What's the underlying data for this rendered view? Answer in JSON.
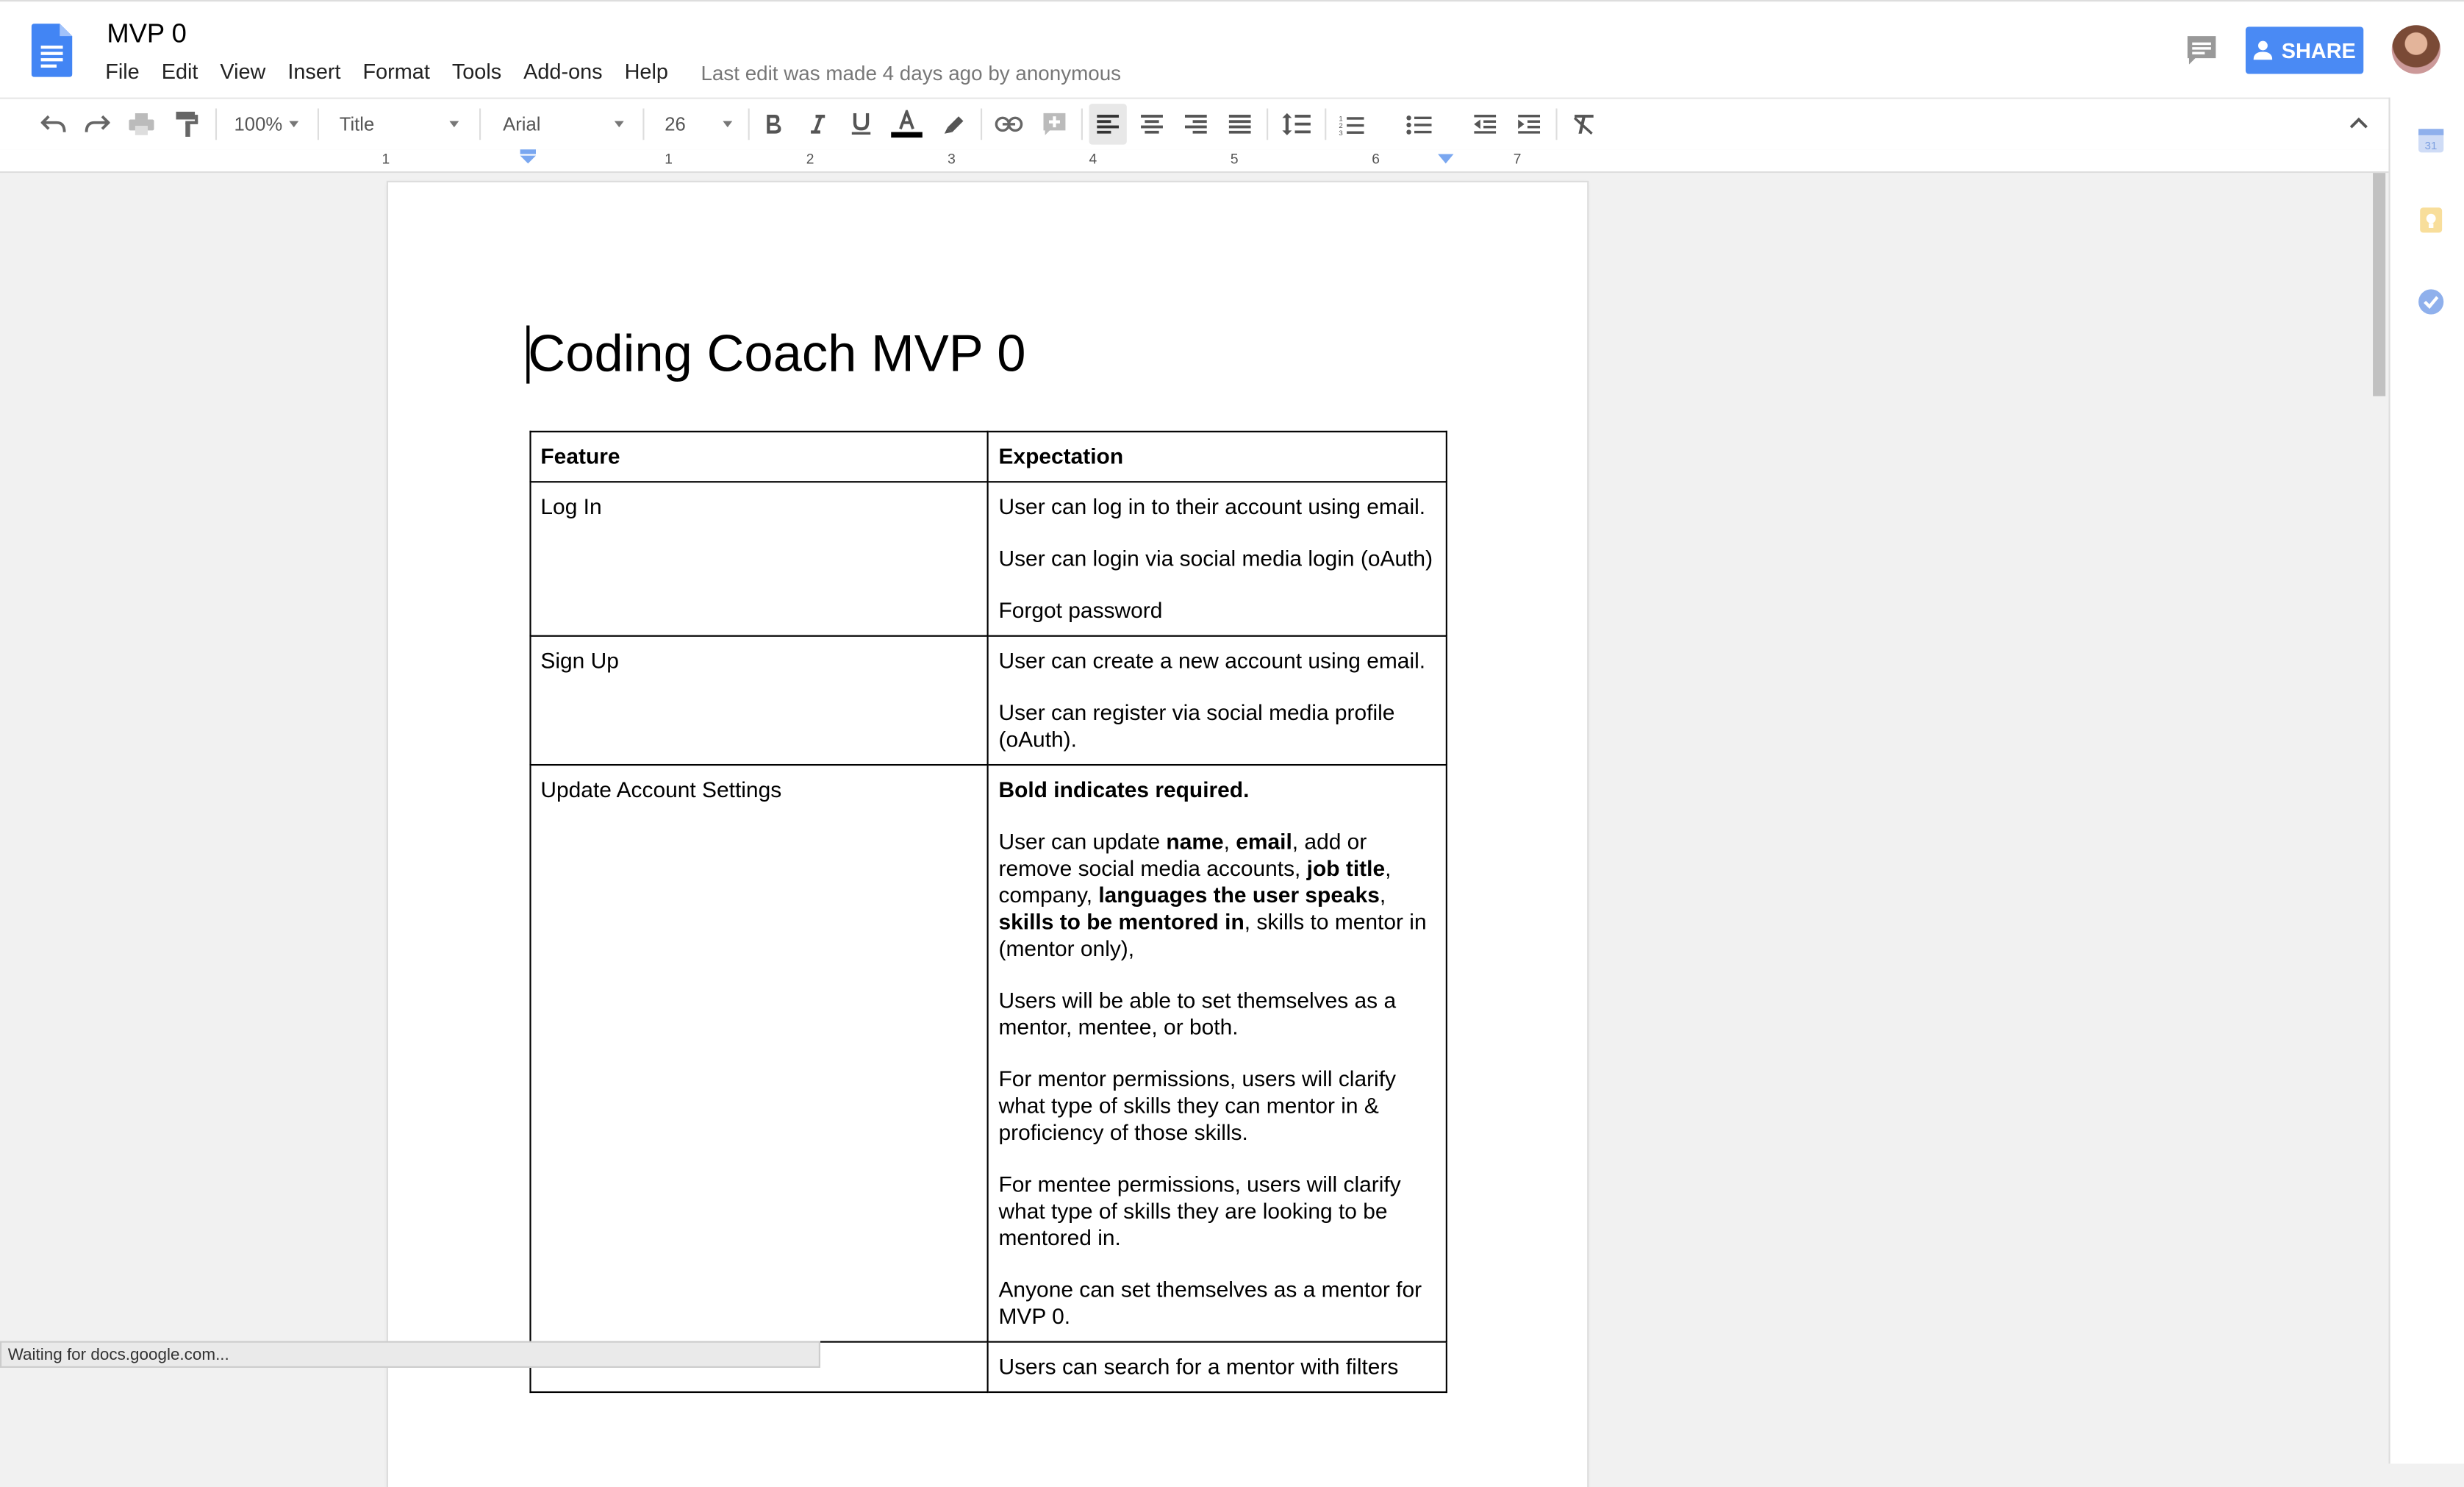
{
  "header": {
    "doc_title": "MVP 0",
    "menu": [
      "File",
      "Edit",
      "View",
      "Insert",
      "Format",
      "Tools",
      "Add-ons",
      "Help"
    ],
    "last_edit": "Last edit was made 4 days ago by anonymous",
    "share_label": "SHARE",
    "share_color": "#4a8af4"
  },
  "toolbar": {
    "zoom": "100%",
    "style": "Title",
    "font": "Arial",
    "font_size": "26",
    "text_color": "#000000"
  },
  "ruler": {
    "numbers": [
      "1",
      "1",
      "2",
      "3",
      "4",
      "5",
      "6",
      "7"
    ]
  },
  "document": {
    "heading": "Coding Coach MVP 0",
    "table": {
      "headers": [
        "Feature",
        "Expectation"
      ],
      "rows": [
        {
          "feature": "Log In",
          "exp": [
            "User can log in to their account using email.",
            "User can login via social media login (oAuth)",
            "Forgot password"
          ]
        },
        {
          "feature": "Sign Up",
          "exp": [
            "User can create a new account using email.",
            "User can register via social media profile (oAuth)."
          ]
        },
        {
          "feature": "Update Account Settings",
          "exp_bold_intro": "Bold indicates required.",
          "exp_rich": {
            "t1": "User can update ",
            "b1": "name",
            "t2": ", ",
            "b2": "email",
            "t3": ", add or remove social media accounts, ",
            "b3": "job title",
            "t4": ", company, ",
            "b4": "languages the user speaks",
            "t5": ", ",
            "b5": "skills to be mentored in",
            "t6": ", skills to mentor in (mentor only),"
          },
          "exp": [
            "Users will be able to set themselves as a mentor, mentee, or both.",
            "For mentor permissions, users will clarify what type of skills they can mentor in & proficiency of those skills.",
            "For mentee permissions, users will clarify what type of skills they are looking to be mentored in.",
            "Anyone can set themselves as a mentor for MVP 0."
          ]
        },
        {
          "feature": "",
          "exp": [
            "Users can search for a mentor with filters"
          ]
        }
      ]
    }
  },
  "status": "Waiting for docs.google.com...",
  "icons": [
    "docs-logo-icon",
    "comment-icon",
    "share-person-icon",
    "undo-icon",
    "redo-icon",
    "print-icon",
    "paint-format-icon",
    "bold-icon",
    "italic-icon",
    "underline-icon",
    "text-color-icon",
    "highlight-icon",
    "link-icon",
    "insert-comment-icon",
    "align-left-icon",
    "align-center-icon",
    "align-right-icon",
    "align-justify-icon",
    "line-spacing-icon",
    "numbered-list-icon",
    "bulleted-list-icon",
    "decrease-indent-icon",
    "increase-indent-icon",
    "clear-formatting-icon",
    "collapse-icon",
    "calendar-icon",
    "keep-icon",
    "tasks-icon"
  ]
}
